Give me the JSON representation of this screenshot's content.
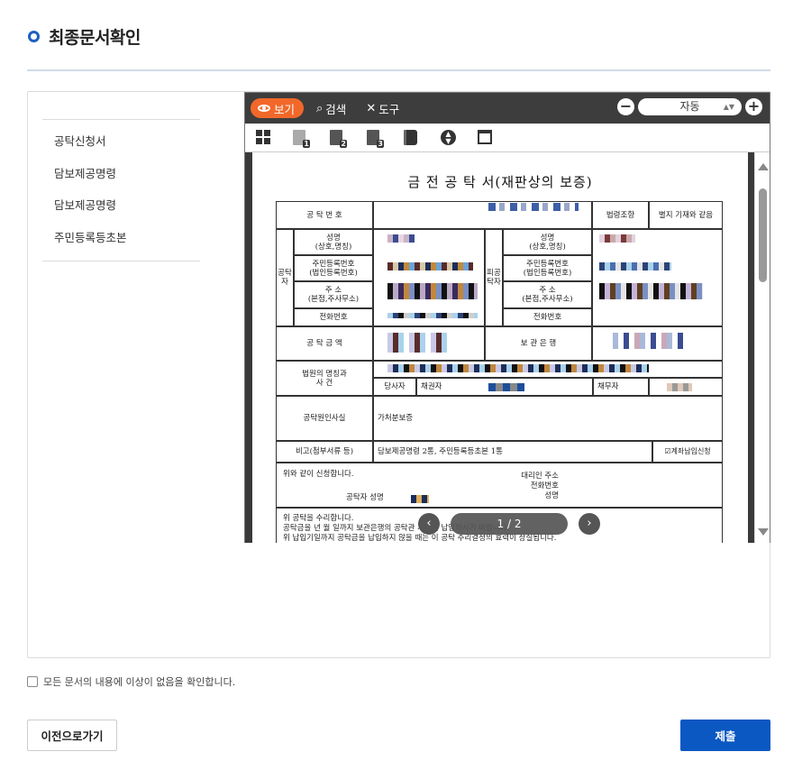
{
  "page": {
    "title": "최종문서확인",
    "accent": "#1e5fc0"
  },
  "documents": {
    "items": [
      {
        "label": "공탁신청서"
      },
      {
        "label": "담보제공명령"
      },
      {
        "label": "담보제공명령"
      },
      {
        "label": "주민등록등초본"
      }
    ]
  },
  "viewer": {
    "tabs": {
      "view": "보기",
      "search": "검색",
      "tools": "도구"
    },
    "zoom": {
      "value": "자동",
      "minus": "−",
      "plus": "+"
    },
    "pager": {
      "text": "1 / 2",
      "prev": "‹",
      "next": "›"
    },
    "toolbar_icons": [
      "grid-icon",
      "page-1-icon",
      "page-2-icon",
      "page-3-icon",
      "book-icon",
      "updown-icon",
      "presentation-icon"
    ],
    "accent": "#f2682a"
  },
  "document": {
    "title": "금 전 공 탁 서(재판상의 보증)",
    "cells": {
      "deposit_no": "공 탁 번 호",
      "law_clause": "법령조항",
      "law_note": "별지 기재와 같음",
      "depositor": "공탁자",
      "depositee": "피공탁자",
      "name": "성명\n(상호,명칭)",
      "reg_no": "주민등록번호\n(법인등록번호)",
      "address": "주 소\n(본점,주사무소)",
      "phone": "전화번호",
      "name2": "성명\n(상호,명칭)",
      "reg_no2": "주민등록번호\n(법인등록번호)",
      "address2": "주 소\n(본점,주사무소)",
      "phone2": "전화번호",
      "amount": "공 탁 금 액",
      "bank": "보 관 은 행",
      "court": "법원의 명칭과\n사 건",
      "party": "당사자",
      "creditor": "채권자",
      "debtor": "채무자",
      "cause": "공탁원인사실",
      "cause_value": "가처분보증",
      "remark": "비고(첨부서류 등)",
      "remark_value": "담보제공명령 2통, 주민등록등초본 1통",
      "account_check": "☑계좌납입신청",
      "apply_text": "위와 같이 신청합니다.",
      "agent_addr": "대리인 주소",
      "agent_phone": "전화번호",
      "agent_name": "성명",
      "depositor_sign": "공탁자 성명",
      "accept_line1": "위 공탁을 수리합니다.",
      "accept_line2": "공탁금을    년    월    일까지 보관은행의 공탁관 계좌에 납입하시기 바랍니다.",
      "accept_line3": "위 납입기일까지 공탁금을 납입하지 않을 때는 이 공탁 수리결정의 효력이 상실됩니다."
    }
  },
  "confirm": {
    "label": "모든 문서의 내용에 이상이 없음을 확인합니다."
  },
  "buttons": {
    "prev": "이전으로가기",
    "submit": "제출"
  }
}
